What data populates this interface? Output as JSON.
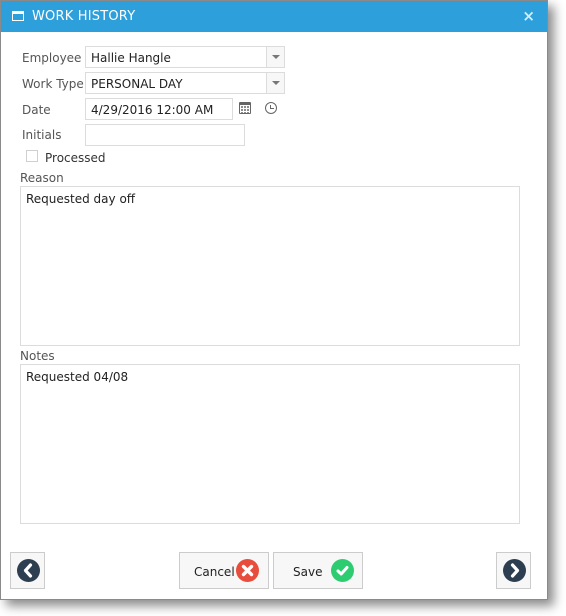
{
  "window": {
    "title": "WORK HISTORY",
    "close_label": "×"
  },
  "form": {
    "employee": {
      "label": "Employee",
      "value": "Hallie Hangle"
    },
    "work_type": {
      "label": "Work Type",
      "value": "PERSONAL DAY"
    },
    "date": {
      "label": "Date",
      "value": "4/29/2016 12:00 AM"
    },
    "initials": {
      "label": "Initials",
      "value": ""
    },
    "processed": {
      "label": "Processed",
      "checked": false
    },
    "reason": {
      "label": "Reason",
      "value": "Requested day off"
    },
    "notes": {
      "label": "Notes",
      "value": "Requested 04/08"
    }
  },
  "footer": {
    "cancel_label": "Cancel",
    "save_label": "Save"
  },
  "colors": {
    "titlebar": "#2d9fdb",
    "cancel_icon": "#e74c3c",
    "save_icon": "#2ecc71",
    "nav_icon": "#2c3e50"
  }
}
